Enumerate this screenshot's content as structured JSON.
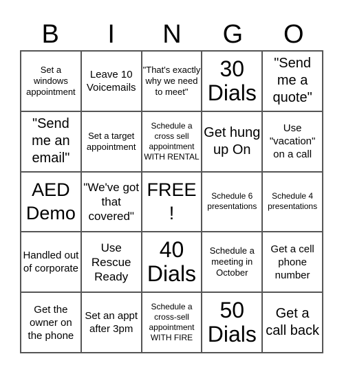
{
  "header": {
    "letters": [
      "B",
      "I",
      "N",
      "G",
      "O"
    ]
  },
  "cells": [
    {
      "text": "Set a windows appointment",
      "size": "s-sm"
    },
    {
      "text": "Leave 10 Voicemails",
      "size": "s-md"
    },
    {
      "text": "\"That's exactly why we need to meet\"",
      "size": "s-sm"
    },
    {
      "text": "30 Dials",
      "size": "s-huge"
    },
    {
      "text": "\"Send me a quote\"",
      "size": "s-xl"
    },
    {
      "text": "\"Send me an email\"",
      "size": "s-xl"
    },
    {
      "text": "Set a target appointment",
      "size": "s-sm"
    },
    {
      "text": "Schedule a cross sell appointment WITH RENTAL",
      "size": "s-xs"
    },
    {
      "text": "Get hung up On",
      "size": "s-xl"
    },
    {
      "text": "Use \"vacation\" on a call",
      "size": "s-md"
    },
    {
      "text": "AED Demo",
      "size": "s-xxl"
    },
    {
      "text": "\"We've got that covered\"",
      "size": "s-lg"
    },
    {
      "text": "FREE !",
      "size": "s-xxl"
    },
    {
      "text": "Schedule 6 presentations",
      "size": "s-xs"
    },
    {
      "text": "Schedule 4 presentations",
      "size": "s-xs"
    },
    {
      "text": "Handled out of corporate",
      "size": "s-md"
    },
    {
      "text": "Use Rescue Ready",
      "size": "s-lg"
    },
    {
      "text": "40 Dials",
      "size": "s-huge"
    },
    {
      "text": "Schedule a meeting in October",
      "size": "s-sm"
    },
    {
      "text": "Get a cell phone number",
      "size": "s-md"
    },
    {
      "text": "Get the owner on the phone",
      "size": "s-md"
    },
    {
      "text": "Set an appt after 3pm",
      "size": "s-md"
    },
    {
      "text": "Schedule a cross-sell appointment WITH FIRE",
      "size": "s-xs"
    },
    {
      "text": "50 Dials",
      "size": "s-huge"
    },
    {
      "text": "Get a call back",
      "size": "s-xl"
    }
  ]
}
